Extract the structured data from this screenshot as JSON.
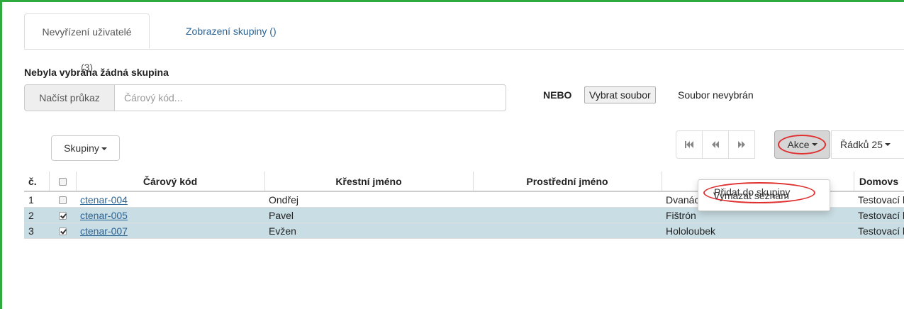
{
  "tabs": [
    {
      "label": "Nevyřízení uživatelé (3)",
      "active": true
    },
    {
      "label": "Zobrazení skupiny ()",
      "active": false
    }
  ],
  "no_group_label": "Nebyla vybrána žádná skupina",
  "scan": {
    "addon_label": "Načíst průkaz",
    "placeholder": "Čárový kód..."
  },
  "file": {
    "or_label": "NEBO",
    "button_label": "Vybrat soubor",
    "status": "Soubor nevybrán"
  },
  "groups_button_label": "Skupiny",
  "pager": {
    "first_icon": "skip-first-icon",
    "prev_icon": "rewind-icon",
    "next_icon": "fast-forward-icon",
    "actions_label": "Akce",
    "rows_label": "Řádků 25"
  },
  "actions_menu": [
    {
      "label": "Přidat do skupiny",
      "highlighted": true
    },
    {
      "label": "Vymazat seznam",
      "highlighted": false
    }
  ],
  "table": {
    "headers": [
      "č.",
      "",
      "Čárový kód",
      "Křestní jméno",
      "Prostřední jméno",
      "",
      "Domovs"
    ],
    "rows": [
      {
        "num": "1",
        "checked": false,
        "barcode": "ctenar-004",
        "first": "Ondřej",
        "middle": "",
        "last": "Dvanáctý",
        "home": "Testovací knih",
        "selected": false
      },
      {
        "num": "2",
        "checked": true,
        "barcode": "ctenar-005",
        "first": "Pavel",
        "middle": "",
        "last": "Fištrón",
        "home": "Testovací knih",
        "selected": true
      },
      {
        "num": "3",
        "checked": true,
        "barcode": "ctenar-007",
        "first": "Evžen",
        "middle": "",
        "last": "Hololoubek",
        "home": "Testovací knih",
        "selected": true
      }
    ]
  },
  "colors": {
    "frame_border": "#2eaa3f",
    "link": "#2a6496",
    "selected_row": "#c9dde4",
    "annotation": "#e03030"
  }
}
